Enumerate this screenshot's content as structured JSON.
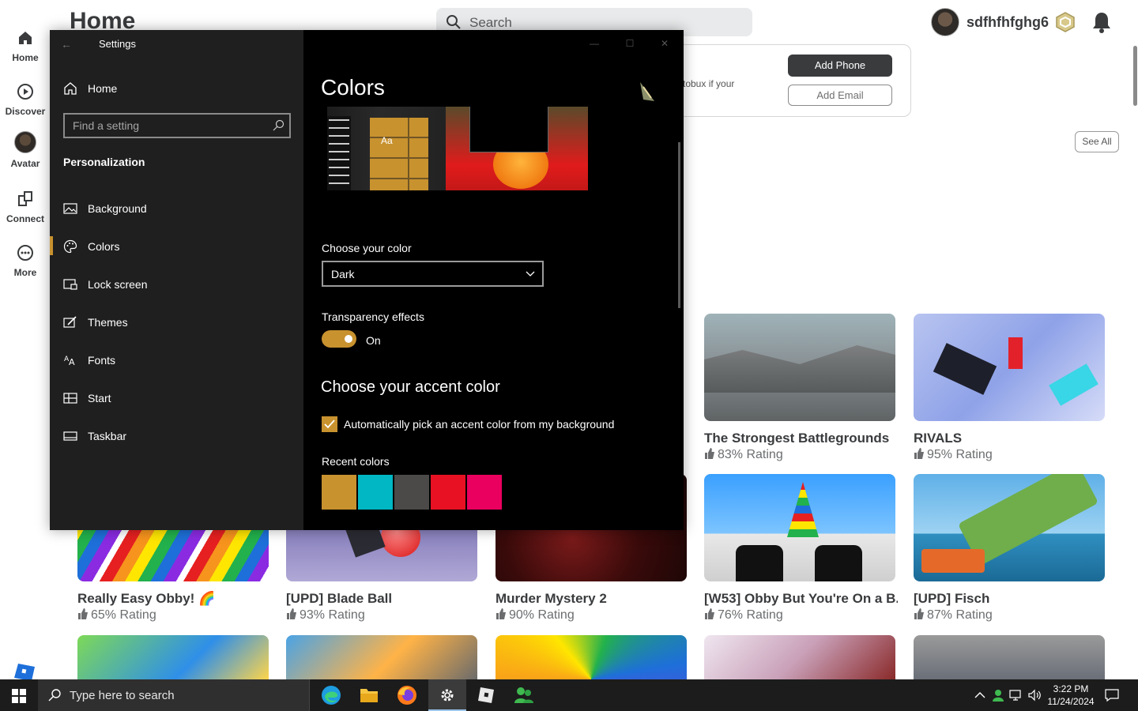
{
  "roblox": {
    "page_title": "Home",
    "search_placeholder": "Search",
    "username": "sdfhfhfghg6",
    "nav": [
      {
        "label": "Home",
        "icon": "home-icon"
      },
      {
        "label": "Discover",
        "icon": "discover-icon"
      },
      {
        "label": "Avatar",
        "icon": "avatar-icon"
      },
      {
        "label": "Connect",
        "icon": "connect-icon"
      },
      {
        "label": "More",
        "icon": "more-icon"
      }
    ],
    "card_text": "tobux if your",
    "add_phone": "Add Phone",
    "add_email": "Add Email",
    "see_all": "See All",
    "games": [
      {
        "name": "The Strongest Battlegrounds",
        "rating": "83% Rating"
      },
      {
        "name": "RIVALS",
        "rating": "95% Rating"
      },
      {
        "name": "Really Easy Obby! 🌈",
        "rating": "65% Rating"
      },
      {
        "name": "[UPD] Blade Ball",
        "rating": "93% Rating"
      },
      {
        "name": "Murder Mystery 2",
        "rating": "90% Rating"
      },
      {
        "name": "[W53] Obby But You're On a B...",
        "rating": "76% Rating"
      },
      {
        "name": "[UPD] Fisch",
        "rating": "87% Rating"
      }
    ]
  },
  "settings": {
    "window_title": "Settings",
    "home_label": "Home",
    "search_placeholder": "Find a setting",
    "section": "Personalization",
    "nav_items": [
      {
        "label": "Background",
        "icon": "image-icon"
      },
      {
        "label": "Colors",
        "icon": "palette-icon",
        "active": true
      },
      {
        "label": "Lock screen",
        "icon": "lock-screen-icon"
      },
      {
        "label": "Themes",
        "icon": "themes-icon"
      },
      {
        "label": "Fonts",
        "icon": "fonts-icon"
      },
      {
        "label": "Start",
        "icon": "start-icon"
      },
      {
        "label": "Taskbar",
        "icon": "taskbar-icon"
      }
    ],
    "page_title": "Colors",
    "preview_sample_text": "Aa",
    "choose_color_label": "Choose your color",
    "choose_color_value": "Dark",
    "transparency_label": "Transparency effects",
    "transparency_state": "On",
    "accent_title": "Choose your accent color",
    "auto_accent_label": "Automatically pick an accent color from my background",
    "recent_colors_label": "Recent colors",
    "recent_colors": [
      "#c8922f",
      "#00b7c3",
      "#4c4a48",
      "#e81123",
      "#ea005e"
    ],
    "accent_color": "#c8922f"
  },
  "taskbar": {
    "search_placeholder": "Type here to search",
    "time": "3:22 PM",
    "date": "11/24/2024",
    "apps": [
      "edge-icon",
      "file-explorer-icon",
      "firefox-icon",
      "settings-icon",
      "roblox-icon",
      "people-icon"
    ]
  }
}
